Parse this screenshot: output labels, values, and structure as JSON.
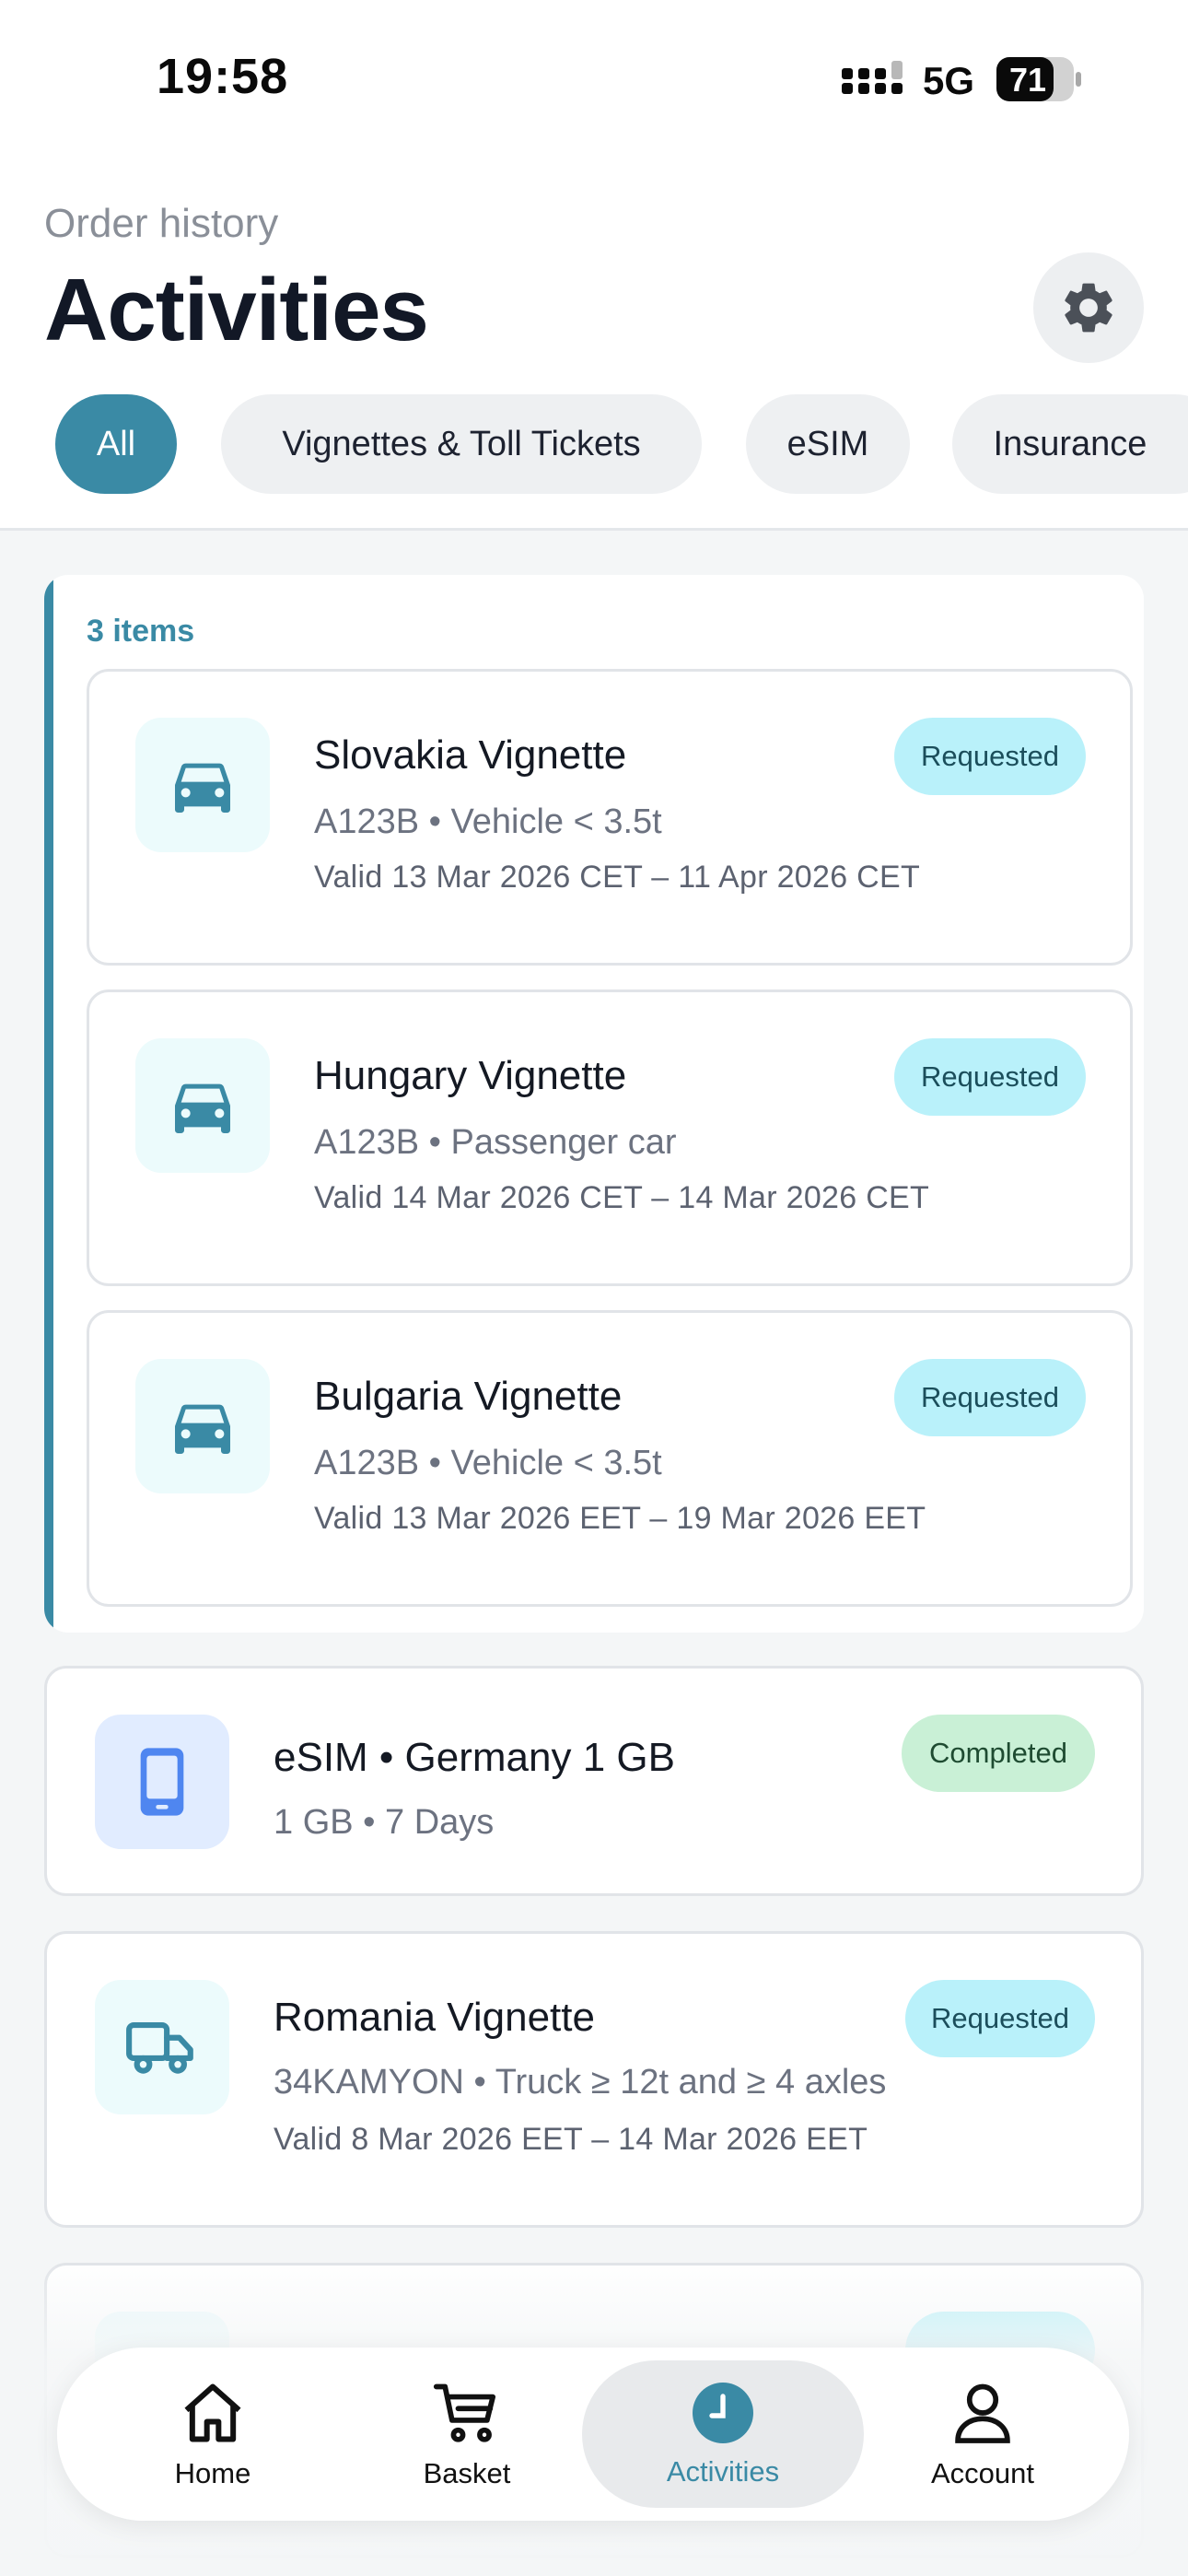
{
  "status_bar": {
    "time": "19:58",
    "network": "5G",
    "battery": "71"
  },
  "header": {
    "subtitle": "Order history",
    "title": "Activities"
  },
  "filters": [
    "All",
    "Vignettes & Toll Tickets",
    "eSIM",
    "Insurance"
  ],
  "group": {
    "count_label": "3 items",
    "items": [
      {
        "title": "Slovakia Vignette",
        "line1": "A123B • Vehicle < 3.5t",
        "line2": "Valid 13 Mar 2026 CET – 11 Apr 2026 CET",
        "status": "Requested",
        "icon": "car-icon"
      },
      {
        "title": "Hungary Vignette",
        "line1": "A123B • Passenger car",
        "line2": "Valid 14 Mar 2026 CET – 14 Mar 2026 CET",
        "status": "Requested",
        "icon": "car-icon"
      },
      {
        "title": "Bulgaria Vignette",
        "line1": "A123B • Vehicle < 3.5t",
        "line2": "Valid 13 Mar 2026 EET – 19 Mar 2026 EET",
        "status": "Requested",
        "icon": "car-icon"
      }
    ]
  },
  "orders": [
    {
      "title": "eSIM • Germany 1 GB",
      "line1": "1 GB • 7 Days",
      "status": "Completed",
      "icon": "phone-icon"
    },
    {
      "title": "Romania Vignette",
      "line1": "34KAMYON • Truck ≥ 12t and ≥ 4 axles",
      "line2": "Valid 8 Mar 2026 EET – 14 Mar 2026 EET",
      "status": "Requested",
      "icon": "truck-icon"
    }
  ],
  "nav": [
    {
      "label": "Home",
      "icon": "home-icon"
    },
    {
      "label": "Basket",
      "icon": "cart-icon"
    },
    {
      "label": "Activities",
      "icon": "clock-icon"
    },
    {
      "label": "Account",
      "icon": "person-icon"
    }
  ],
  "colors": {
    "accent": "#3a8aa5",
    "requested_badge": "#b9f1fa",
    "completed_badge": "#c9f0d6"
  }
}
